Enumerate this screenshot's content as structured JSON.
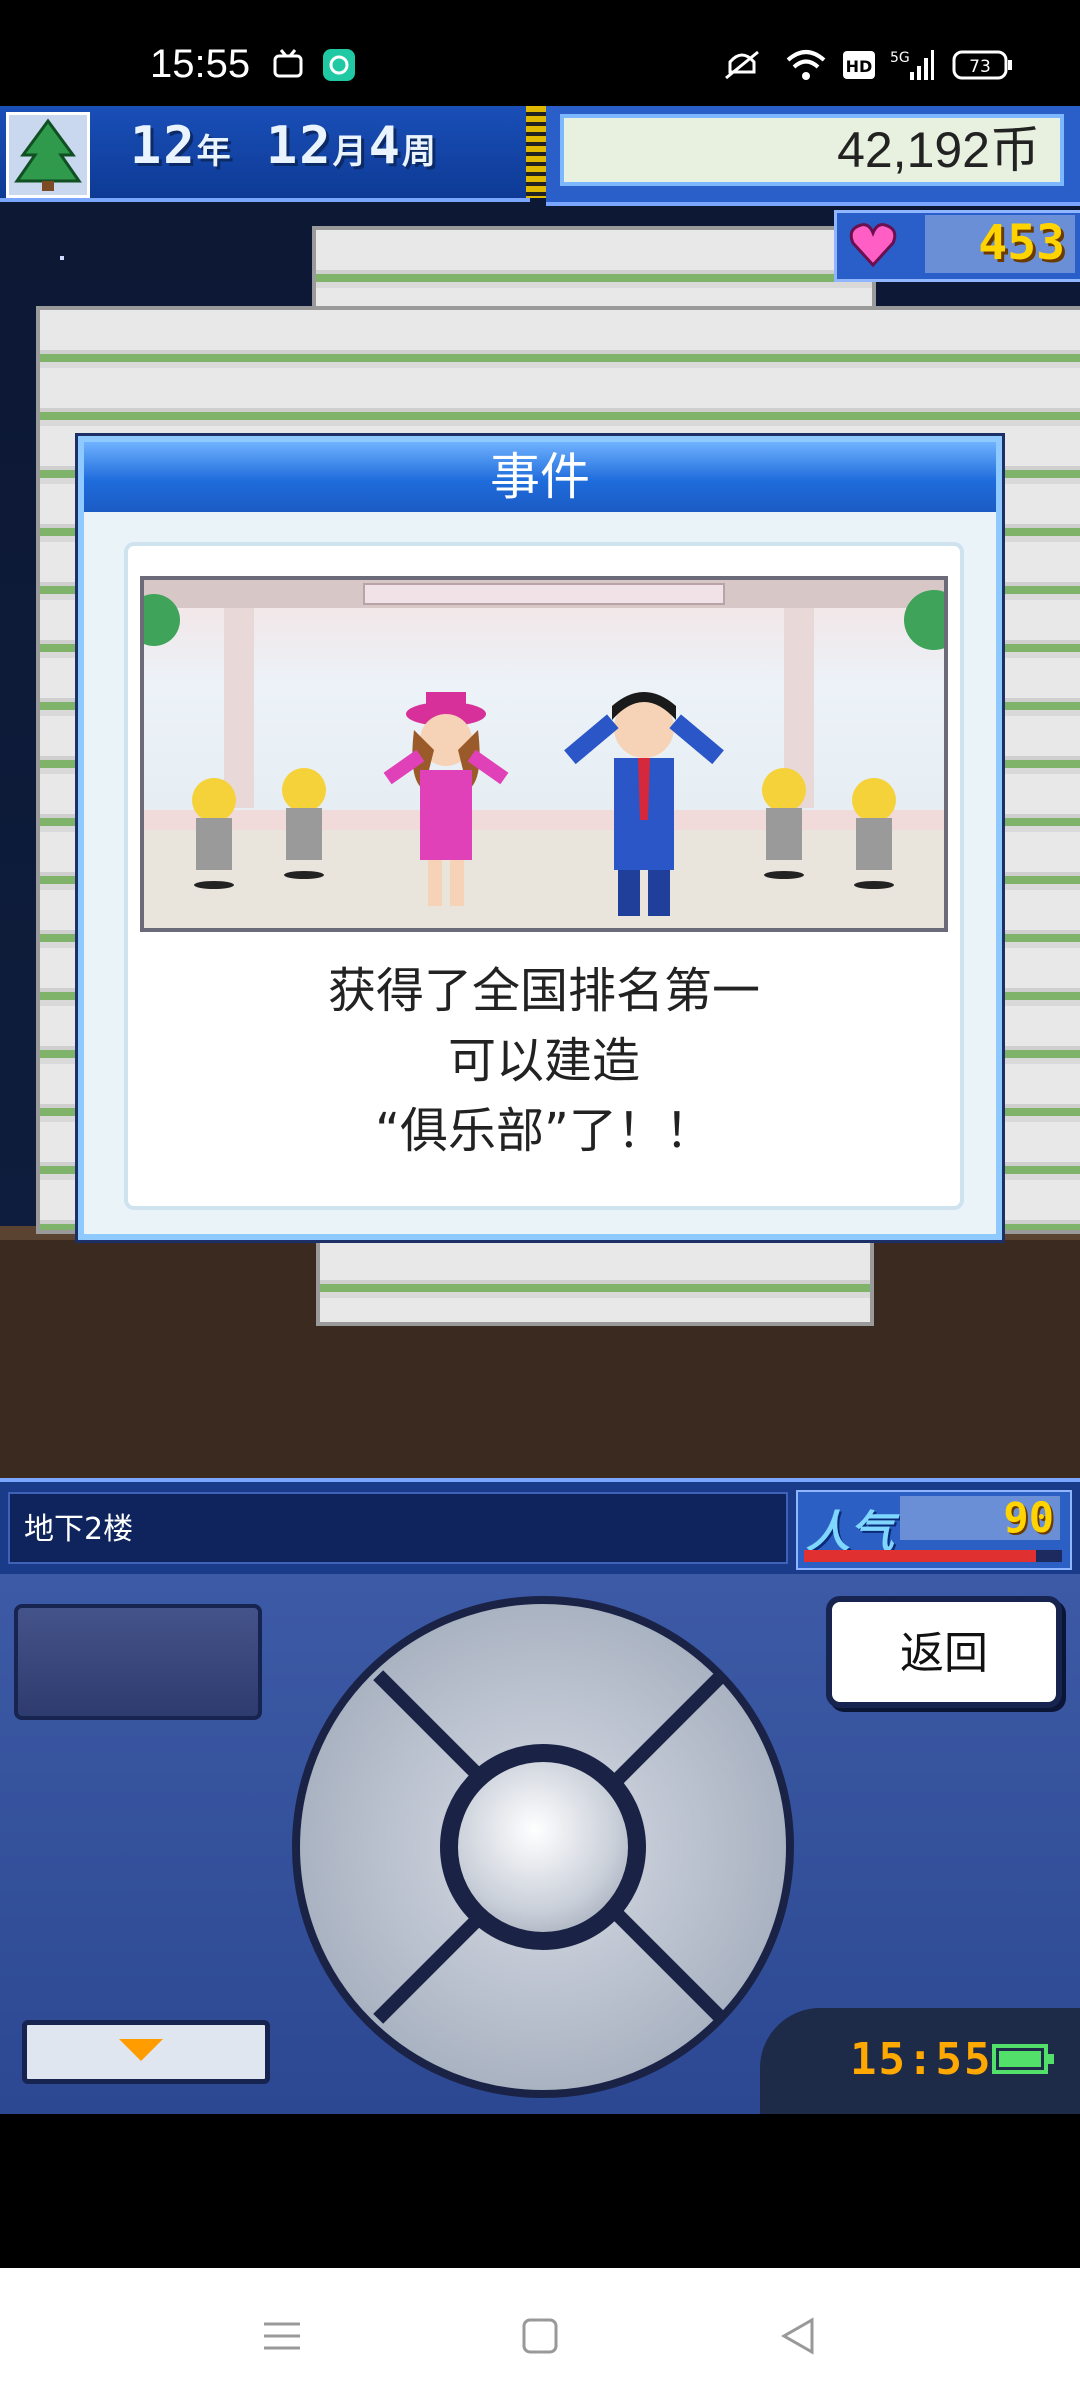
{
  "status_bar": {
    "time": "15:55",
    "network": "5G",
    "hd": "HD",
    "battery": "73"
  },
  "hud": {
    "year": "12",
    "year_unit": "年",
    "month": "12",
    "month_unit": "月",
    "week": "4",
    "week_unit": "周",
    "money": "42,192币",
    "hearts": "453"
  },
  "event_dialog": {
    "title": "事件",
    "line1": "获得了全国排名第一",
    "line2": "可以建造",
    "line3": "“俱乐部”了！！"
  },
  "panel": {
    "floor_label": "地下2楼",
    "popularity_label": "人气",
    "popularity_value": "90",
    "popularity_level": 0.9,
    "back_label": "返回",
    "clock": "15:55"
  },
  "icons": [
    "tree-icon",
    "heart-icon",
    "mute-icon",
    "wifi-icon",
    "signal-icon",
    "battery-icon",
    "menu-icon",
    "home-icon",
    "back-icon",
    "dropdown-arrow-icon"
  ]
}
